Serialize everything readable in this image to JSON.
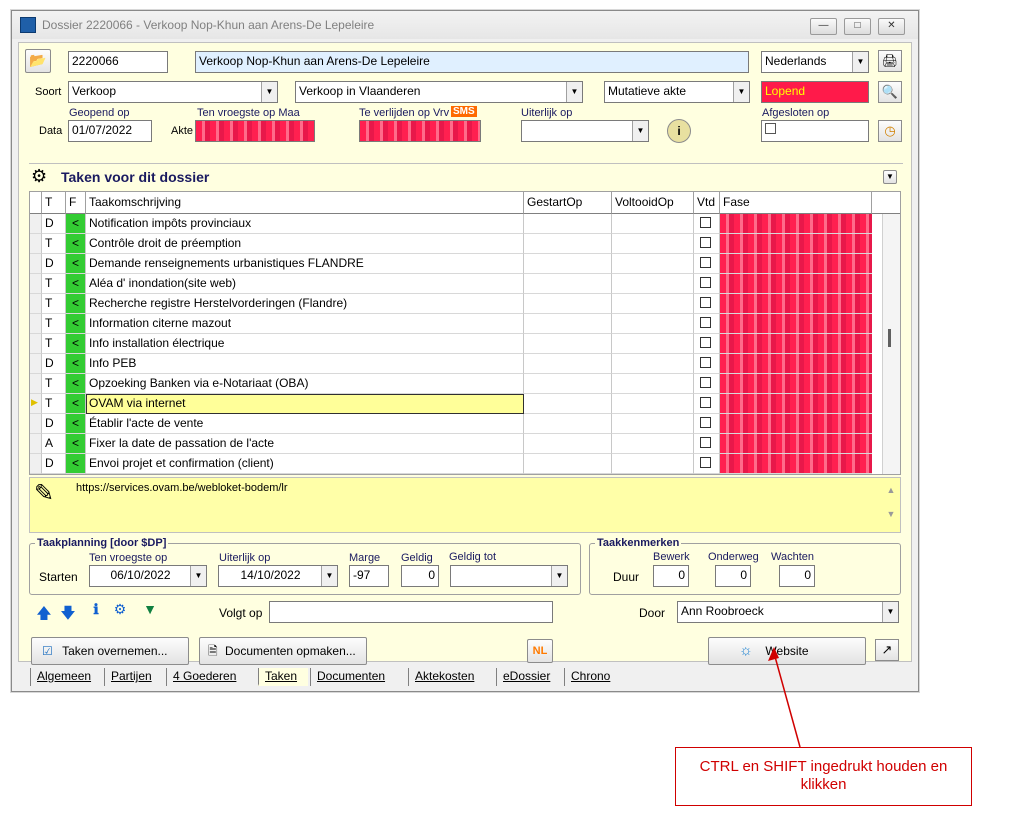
{
  "window": {
    "title": "Dossier 2220066 - Verkoop Nop-Khun aan Arens-De Lepeleire"
  },
  "header": {
    "dossier_number": "2220066",
    "dossier_name": "Verkoop Nop-Khun aan Arens-De Lepeleire",
    "language": "Nederlands",
    "soort_label": "Soort",
    "soort_value": "Verkoop",
    "subtype_value": "Verkoop in Vlaanderen",
    "akte_type": "Mutatieve akte",
    "status": "Lopend",
    "geopend_op_label": "Geopend op",
    "data_label": "Data",
    "geopend_op_value": "01/07/2022",
    "ten_vroegste_label": "Ten vroegste op Maa",
    "akte_label": "Akte",
    "te_verlijden_label": "Te verlijden op Vrv",
    "sms_badge": "SMS",
    "uiterlijk_op_label": "Uiterlijk op",
    "afgesloten_op_label": "Afgesloten op"
  },
  "tasks": {
    "title": "Taken voor dit dossier",
    "columns": [
      "T",
      "F",
      "Taakomschrijving",
      "GestartOp",
      "VoltooidOp",
      "Vtd",
      "Fase"
    ],
    "rows": [
      {
        "t": "D",
        "f": "<",
        "desc": "Notification impôts provinciaux"
      },
      {
        "t": "T",
        "f": "<",
        "desc": "Contrôle droit de préemption"
      },
      {
        "t": "D",
        "f": "<",
        "desc": "Demande renseignements urbanistiques FLANDRE"
      },
      {
        "t": "T",
        "f": "<",
        "desc": "Aléa d' inondation(site web)"
      },
      {
        "t": "T",
        "f": "<",
        "desc": "Recherche registre Herstelvorderingen (Flandre)"
      },
      {
        "t": "T",
        "f": "<",
        "desc": "Information citerne mazout"
      },
      {
        "t": "T",
        "f": "<",
        "desc": "Info installation électrique"
      },
      {
        "t": "D",
        "f": "<",
        "desc": "Info PEB"
      },
      {
        "t": "T",
        "f": "<",
        "desc": "Opzoeking Banken via e-Notariaat (OBA)"
      },
      {
        "t": "T",
        "f": "<",
        "desc": "OVAM via internet"
      },
      {
        "t": "D",
        "f": "<",
        "desc": "Établir l'acte de vente"
      },
      {
        "t": "A",
        "f": "<",
        "desc": "Fixer la date de passation de l'acte"
      },
      {
        "t": "D",
        "f": "<",
        "desc": "Envoi projet et confirmation (client)"
      }
    ],
    "selected_index": 9,
    "note": "https://services.ovam.be/webloket-bodem/lr"
  },
  "planning": {
    "group_title": "Taakplanning  [door $DP]",
    "starten_label": "Starten",
    "ten_vroegste_label": "Ten vroegste op",
    "ten_vroegste_value": "06/10/2022",
    "uiterlijk_label": "Uiterlijk op",
    "uiterlijk_value": "14/10/2022",
    "marge_label": "Marge",
    "marge_value": "-97",
    "geldig_label": "Geldig",
    "geldig_value": "0",
    "geldig_tot_label": "Geldig tot"
  },
  "kenmerken": {
    "group_title": "Taakkenmerken",
    "duur_label": "Duur",
    "bewerk_label": "Bewerk",
    "bewerk_value": "0",
    "onderweg_label": "Onderweg",
    "onderweg_value": "0",
    "wachten_label": "Wachten",
    "wachten_value": "0"
  },
  "bottom": {
    "volgt_op_label": "Volgt op",
    "door_label": "Door",
    "door_value": "Ann Roobroeck",
    "taken_overnemen": "Taken overnemen...",
    "documenten_opmaken": "Documenten opmaken...",
    "nl_badge": "NL",
    "website_button": "Website"
  },
  "tabs": [
    "Algemeen",
    "Partijen",
    "4 Goederen",
    "Taken",
    "Documenten",
    "Aktekosten",
    "eDossier",
    "Chrono"
  ],
  "active_tab": "Taken",
  "callout": {
    "text": "CTRL en SHIFT ingedrukt houden en klikken"
  },
  "colors": {
    "status_red": "#ff1a4a",
    "grid_green": "#33cc33",
    "selected_yellow": "#ffff99",
    "callout_red": "#d00000",
    "panel_yellow": "#ffffe0"
  }
}
